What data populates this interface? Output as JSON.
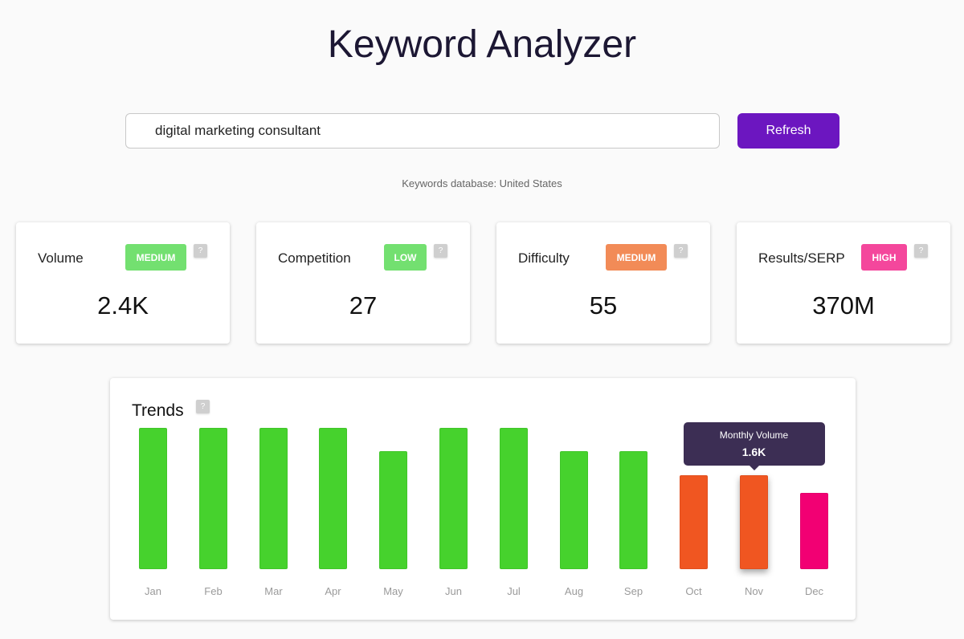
{
  "header": {
    "title": "Keyword Analyzer"
  },
  "search": {
    "value": "digital marketing consultant",
    "refresh_label": "Refresh"
  },
  "database_note": "Keywords database: United States",
  "help_glyph": "?",
  "metrics": [
    {
      "label": "Volume",
      "badge": "MEDIUM",
      "badge_color": "#73e070",
      "value": "2.4K"
    },
    {
      "label": "Competition",
      "badge": "LOW",
      "badge_color": "#73e070",
      "value": "27"
    },
    {
      "label": "Difficulty",
      "badge": "MEDIUM",
      "badge_color": "#f28b57",
      "value": "55"
    },
    {
      "label": "Results/SERP",
      "badge": "HIGH",
      "badge_color": "#f4479c",
      "value": "370M"
    }
  ],
  "trends": {
    "title": "Trends",
    "tooltip": {
      "label": "Monthly Volume",
      "value": "1.6K",
      "month": "Nov"
    }
  },
  "chart_data": {
    "type": "bar",
    "title": "Trends",
    "xlabel": "",
    "ylabel": "Monthly Volume",
    "categories": [
      "Jan",
      "Feb",
      "Mar",
      "Apr",
      "May",
      "Jun",
      "Jul",
      "Aug",
      "Sep",
      "Oct",
      "Nov",
      "Dec"
    ],
    "values": [
      2400,
      2400,
      2400,
      2400,
      2000,
      2400,
      2400,
      2000,
      2000,
      1600,
      1600,
      1300
    ],
    "colors": [
      "#46d22d",
      "#46d22d",
      "#46d22d",
      "#46d22d",
      "#46d22d",
      "#46d22d",
      "#46d22d",
      "#46d22d",
      "#46d22d",
      "#f05621",
      "#f05621",
      "#f20073"
    ],
    "ylim": [
      0,
      2400
    ],
    "grid": false,
    "highlighted": "Nov"
  }
}
